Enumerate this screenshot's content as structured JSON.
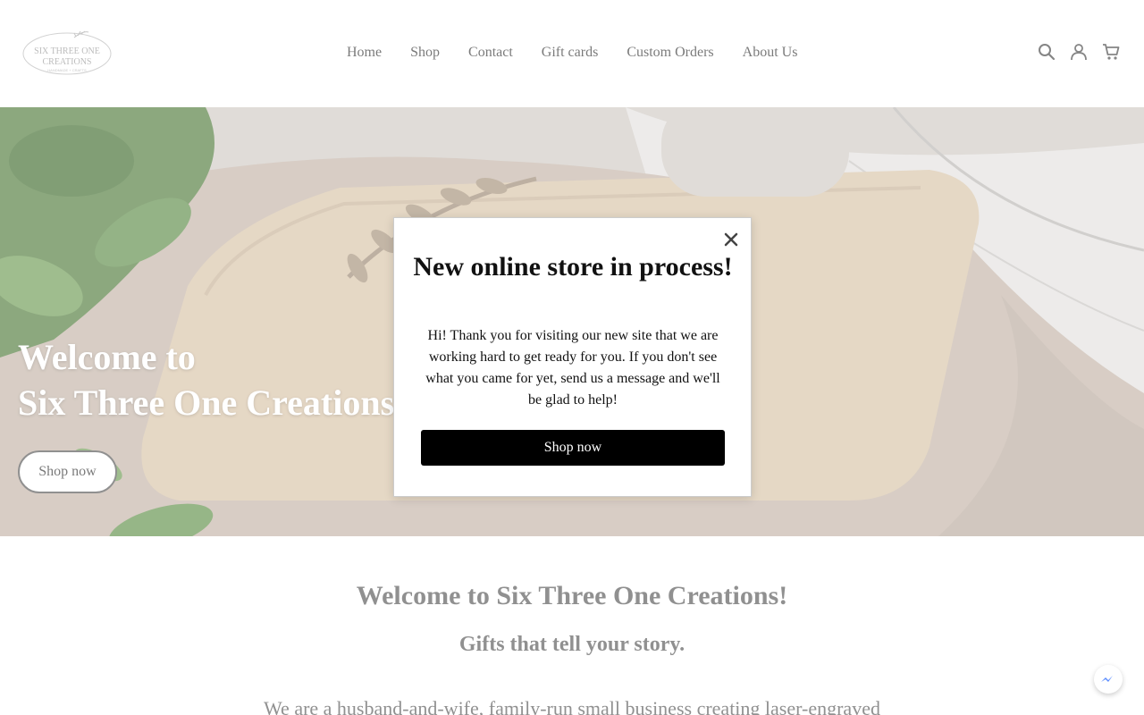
{
  "brand": {
    "logo_line1": "SIX THREE ONE",
    "logo_line2": "CREATIONS",
    "logo_line3": "HANDMADE + CRAFTS"
  },
  "nav": {
    "items": [
      {
        "label": "Home"
      },
      {
        "label": "Shop"
      },
      {
        "label": "Contact"
      },
      {
        "label": "Gift cards"
      },
      {
        "label": "Custom Orders"
      },
      {
        "label": "About Us"
      }
    ]
  },
  "header_icons": [
    "search-icon",
    "account-icon",
    "cart-icon"
  ],
  "hero": {
    "title_line1": "Welcome to",
    "title_line2": "Six Three One Creations",
    "button_label": "Shop now"
  },
  "intro": {
    "title": "Welcome to Six Three One Creations!",
    "subtitle": "Gifts that tell your story.",
    "body": "We are a husband-and-wife, family-run small business creating laser-engraved"
  },
  "modal": {
    "title": "New online store in process!",
    "body": "Hi! Thank you for visiting our new site that we are working hard to get ready for you. If you don't see what you came for yet, send us a message and we'll be glad to help!",
    "button_label": "Shop now",
    "close_icon": "close-icon"
  },
  "chat_icon": "messenger-icon",
  "colors": {
    "modal_button_bg": "#000000",
    "text_muted": "#555555",
    "hero_overlay": "#ffffff"
  }
}
